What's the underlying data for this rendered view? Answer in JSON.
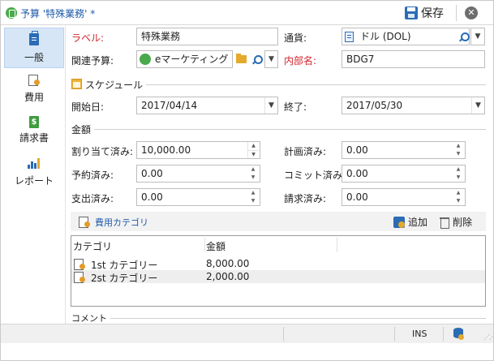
{
  "window": {
    "title": "予算 '特殊業務' *",
    "save_label": "保存",
    "close_label": "✕"
  },
  "sidebar": {
    "items": [
      {
        "label": "一般",
        "icon": "clipboard-icon",
        "active": true
      },
      {
        "label": "費用",
        "icon": "cost-icon"
      },
      {
        "label": "請求書",
        "icon": "invoice-icon"
      },
      {
        "label": "レポート",
        "icon": "report-icon"
      }
    ]
  },
  "form": {
    "label_caption": "ラベル:",
    "label_value": "特殊業務",
    "currency_caption": "通貨:",
    "currency_value": "ドル (DOL)",
    "related_caption": "関連予算:",
    "related_value": "eマーケティング",
    "internal_caption": "内部名:",
    "internal_value": "BDG7"
  },
  "schedule": {
    "title": "スケジュール",
    "start_caption": "開始日:",
    "start_value": "2017/04/14",
    "end_caption": "終了:",
    "end_value": "2017/05/30"
  },
  "amounts": {
    "title": "金額",
    "allocated_caption": "割り当て済み:",
    "allocated_value": "10,000.00",
    "planned_caption": "計画済み:",
    "planned_value": "0.00",
    "reserved_caption": "予約済み:",
    "reserved_value": "0.00",
    "committed_caption": "コミット済み:",
    "committed_value": "0.00",
    "paid_caption": "支出済み:",
    "paid_value": "0.00",
    "invoiced_caption": "請求済み:",
    "invoiced_value": "0.00"
  },
  "categories": {
    "title": "費用カテゴリ",
    "add_label": "追加",
    "delete_label": "削除",
    "columns": [
      "カテゴリ",
      "金額"
    ],
    "rows": [
      {
        "category": "1st カテゴリー",
        "amount": "8,000.00"
      },
      {
        "category": "2st カテゴリー",
        "amount": "2,000.00"
      }
    ]
  },
  "comment": {
    "title": "コメント"
  },
  "statusbar": {
    "ins": "INS"
  },
  "colors": {
    "accent": "#1f5aa8",
    "required_label": "#d2262c",
    "selection": "#d6e6f7"
  }
}
